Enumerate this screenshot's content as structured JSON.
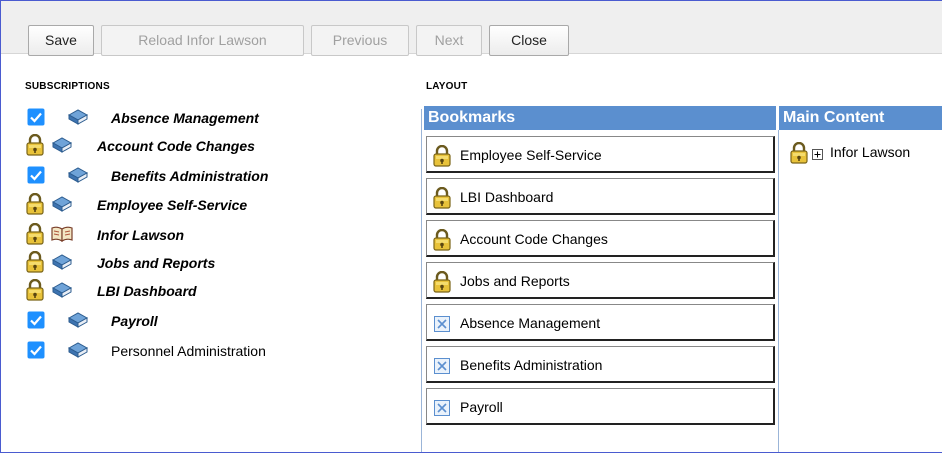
{
  "toolbar": {
    "buttons": [
      {
        "label": "Save",
        "enabled": true
      },
      {
        "label": "Reload Infor Lawson",
        "enabled": false
      },
      {
        "label": "Previous",
        "enabled": false
      },
      {
        "label": "Next",
        "enabled": false
      },
      {
        "label": "Close",
        "enabled": true
      }
    ]
  },
  "subscriptions": {
    "title": "Subscriptions",
    "items": [
      {
        "label": "Absence Management",
        "state": "checked",
        "icon": "book-icon",
        "bold": true
      },
      {
        "label": "Account Code Changes",
        "state": "locked",
        "icon": "book-icon",
        "bold": true
      },
      {
        "label": "Benefits Administration",
        "state": "checked",
        "icon": "book-icon",
        "bold": true
      },
      {
        "label": "Employee Self-Service",
        "state": "locked",
        "icon": "book-icon",
        "bold": true
      },
      {
        "label": "Infor Lawson",
        "state": "locked",
        "icon": "open-book-icon",
        "bold": true
      },
      {
        "label": "Jobs and Reports",
        "state": "locked",
        "icon": "book-icon",
        "bold": true
      },
      {
        "label": "LBI Dashboard",
        "state": "locked",
        "icon": "book-icon",
        "bold": true
      },
      {
        "label": "Payroll",
        "state": "checked",
        "icon": "book-icon",
        "bold": true
      },
      {
        "label": "Personnel Administration",
        "state": "checked",
        "icon": "book-icon",
        "bold": false
      }
    ]
  },
  "layout": {
    "title": "Layout",
    "bookmarks_header": "Bookmarks",
    "main_content_header": "Main Content",
    "bookmarks": [
      {
        "label": "Employee Self-Service",
        "icon": "lock-icon"
      },
      {
        "label": "LBI Dashboard",
        "icon": "lock-icon"
      },
      {
        "label": "Account Code Changes",
        "icon": "lock-icon"
      },
      {
        "label": "Jobs and Reports",
        "icon": "lock-icon"
      },
      {
        "label": "Absence Management",
        "icon": "remove-icon"
      },
      {
        "label": "Benefits Administration",
        "icon": "remove-icon"
      },
      {
        "label": "Payroll",
        "icon": "remove-icon"
      }
    ],
    "main_content": [
      {
        "label": "Infor Lawson",
        "icon": "lock-icon",
        "expander": "expand-icon"
      }
    ]
  },
  "colors": {
    "header_blue": "#5b8fcf",
    "checkbox_blue": "#1e90ff",
    "frame_border": "#4a5bd0"
  }
}
